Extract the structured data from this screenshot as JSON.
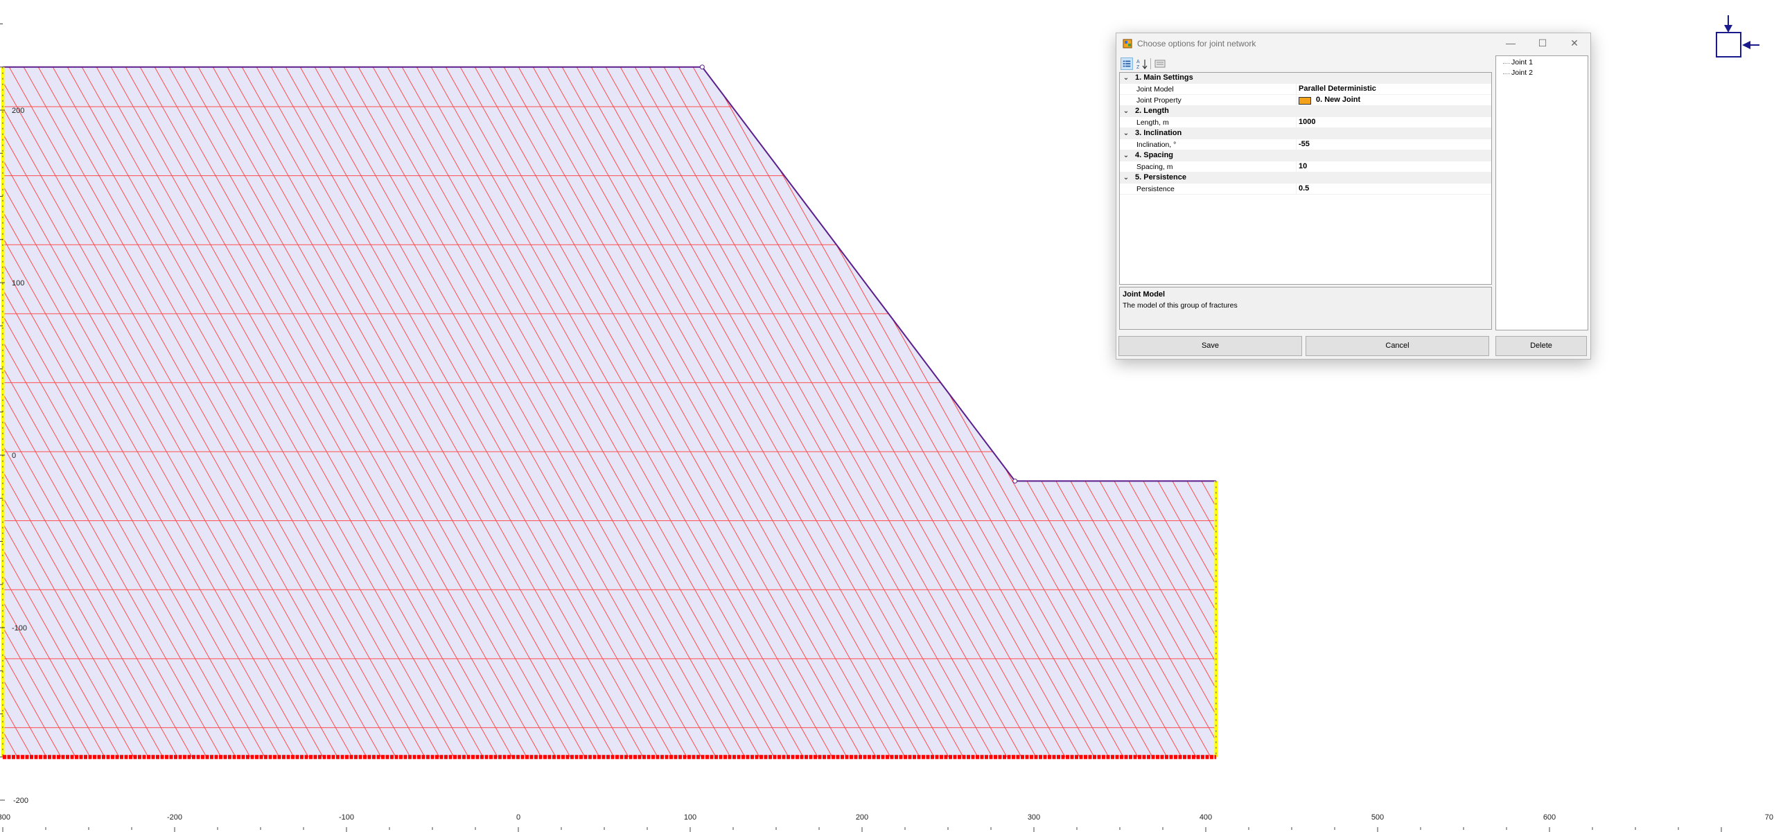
{
  "canvas": {
    "x_axis": {
      "range": [
        -300,
        700
      ],
      "tick_labels": [
        "-300",
        "-200",
        "-100",
        "0",
        "100",
        "200",
        "300",
        "400",
        "500",
        "600",
        "70"
      ]
    },
    "y_axis": {
      "range": [
        -200,
        200
      ],
      "tick_labels": [
        "200",
        "100",
        "0",
        "-100",
        "-200"
      ]
    },
    "slope_outline": [
      [
        -300,
        225
      ],
      [
        107,
        225
      ],
      [
        289,
        -15
      ],
      [
        406,
        -15
      ],
      [
        406,
        -175
      ],
      [
        -300,
        -175
      ]
    ],
    "joint_set_horizontal": {
      "spacing_units": 40,
      "color": "#ff4d4d"
    },
    "joint_set_inclined": {
      "inclination_deg": -55,
      "color": "#ff4d4d"
    },
    "colors": {
      "fill": "#e6e6f8",
      "outline": "#5b1e8c",
      "joints": "#ff4d4d",
      "boundary": "#ffff00",
      "base": "#ff0000"
    }
  },
  "dialog": {
    "title": "Choose options for joint network",
    "window_buttons": {
      "minimize": "—",
      "maximize": "☐",
      "close": "✕"
    },
    "categories": [
      {
        "label": "1. Main Settings",
        "props": [
          {
            "name": "Joint Model",
            "value": "Parallel Deterministic"
          },
          {
            "name": "Joint Property",
            "value": "0. New Joint",
            "swatch": "#f5a21b"
          }
        ]
      },
      {
        "label": "2. Length",
        "props": [
          {
            "name": "Length, m",
            "value": "1000"
          }
        ]
      },
      {
        "label": "3. Inclination",
        "props": [
          {
            "name": "Inclination, °",
            "value": "-55"
          }
        ]
      },
      {
        "label": "4. Spacing",
        "props": [
          {
            "name": "Spacing, m",
            "value": "10"
          }
        ]
      },
      {
        "label": "5. Persistence",
        "props": [
          {
            "name": "Persistence",
            "value": "0.5"
          }
        ]
      }
    ],
    "help": {
      "title": "Joint Model",
      "description": "The model of this group of fractures"
    },
    "joints": [
      "Joint 1",
      "Joint 2"
    ],
    "buttons": {
      "save": "Save",
      "cancel": "Cancel",
      "delete": "Delete"
    }
  }
}
